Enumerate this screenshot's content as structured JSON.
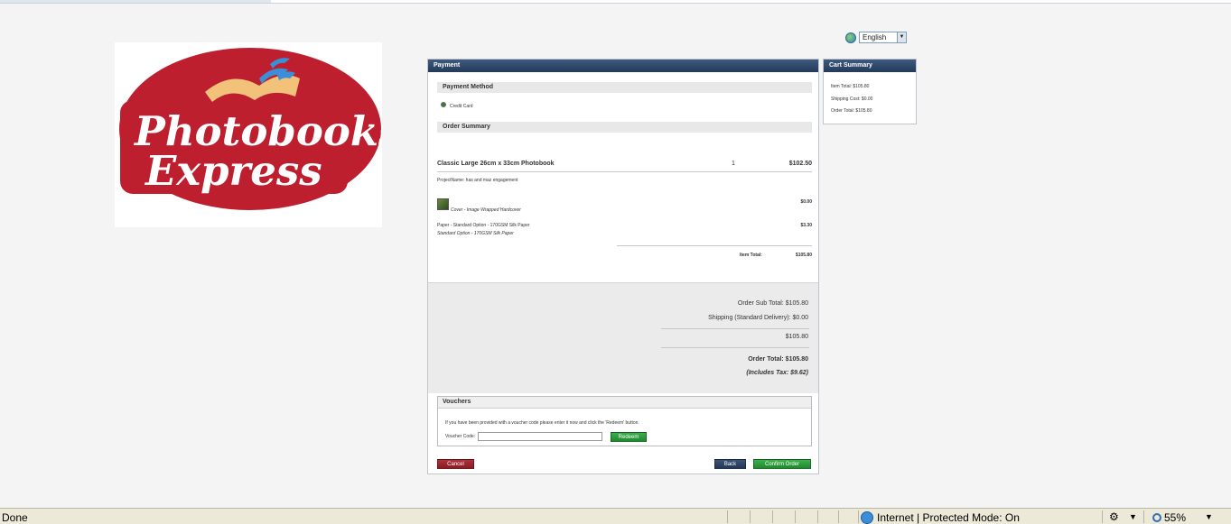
{
  "browser": {
    "status_text": "Done",
    "zone_text": "Internet | Protected Mode: On",
    "zoom_text": "55%"
  },
  "logo": {
    "line1": "Photobooks",
    "line2": "Express"
  },
  "language": {
    "selected": "English"
  },
  "payment": {
    "title": "Payment",
    "method_heading": "Payment Method",
    "method_option": "Credit Card",
    "summary_heading": "Order Summary",
    "item": {
      "name": "Classic Large 26cm x 33cm Photobook",
      "qty": "1",
      "price": "$102.50",
      "project_name": "ProjectName: has and maz engagement",
      "cover_label": "Cover - Image Wrapped Hardcover",
      "cover_price": "$0.00",
      "paper_label": "Paper - Standard Option - 170GSM Silk Paper",
      "paper_sub": "Standard Option - 170GSM Silk Paper",
      "paper_price": "$3.30",
      "item_total_label": "Item Total:",
      "item_total_value": "$105.80"
    },
    "totals": {
      "sub_total": "Order Sub Total: $105.80",
      "shipping": "Shipping (Standard Delivery): $0.00",
      "subtotal2": "$105.80",
      "order_total": "Order Total: $105.80",
      "tax": "(Includes Tax: $9.62)"
    },
    "vouchers": {
      "heading": "Vouchers",
      "instructions": "If you have been provided with a voucher code please enter it now and click the 'Redeem' button.",
      "code_label": "Voucher Code:",
      "code_value": "",
      "redeem_label": "Redeem"
    },
    "buttons": {
      "cancel": "Cancel",
      "back": "Back",
      "confirm": "Confirm Order"
    }
  },
  "cart_summary": {
    "title": "Cart Summary",
    "item_total": "Item Total: $105.80",
    "shipping_cost": "Shipping Cost: $0.00",
    "order_total": "Order Total: $105.80"
  },
  "colors": {
    "header_navy": "#2c4467",
    "brand_red": "#c0202e",
    "confirm_green": "#1f8a2e",
    "cancel_red": "#a32831"
  }
}
